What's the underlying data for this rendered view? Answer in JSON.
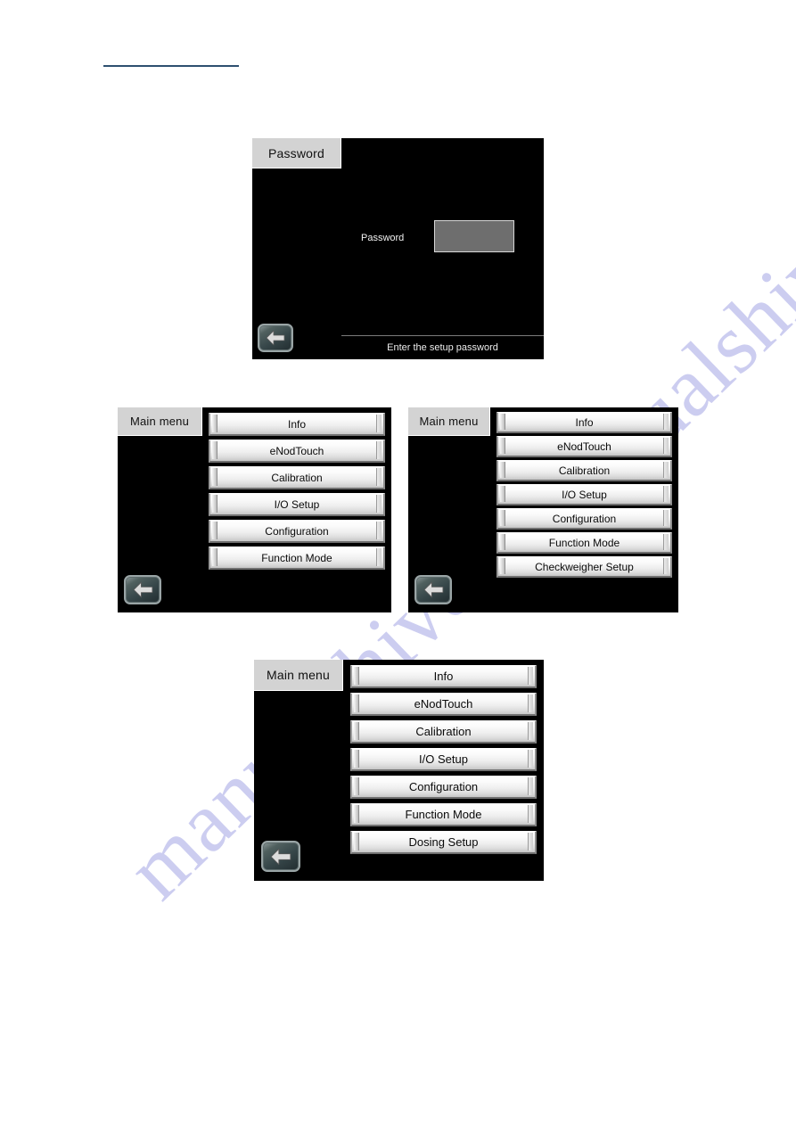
{
  "page": {
    "header_link_text": "",
    "watermark_text": "manualshive.com",
    "watermark_color": "#aeb0e8",
    "link_rule_color": "#2e5070"
  },
  "screens": [
    {
      "id": "password",
      "title": "Password",
      "field_label": "Password",
      "field_value": "",
      "status_text": "Enter the setup password",
      "back_icon": "back-arrow-icon"
    },
    {
      "id": "main-menu-basic",
      "title": "Main menu",
      "back_icon": "back-arrow-icon",
      "items": [
        "Info",
        "eNodTouch",
        "Calibration",
        "I/O Setup",
        "Configuration",
        "Function Mode"
      ]
    },
    {
      "id": "main-menu-checkweigher",
      "title": "Main menu",
      "back_icon": "back-arrow-icon",
      "items": [
        "Info",
        "eNodTouch",
        "Calibration",
        "I/O Setup",
        "Configuration",
        "Function Mode",
        "Checkweigher Setup"
      ]
    },
    {
      "id": "main-menu-dosing",
      "title": "Main menu",
      "back_icon": "back-arrow-icon",
      "items": [
        "Info",
        "eNodTouch",
        "Calibration",
        "I/O Setup",
        "Configuration",
        "Function Mode",
        "Dosing Setup"
      ]
    }
  ]
}
